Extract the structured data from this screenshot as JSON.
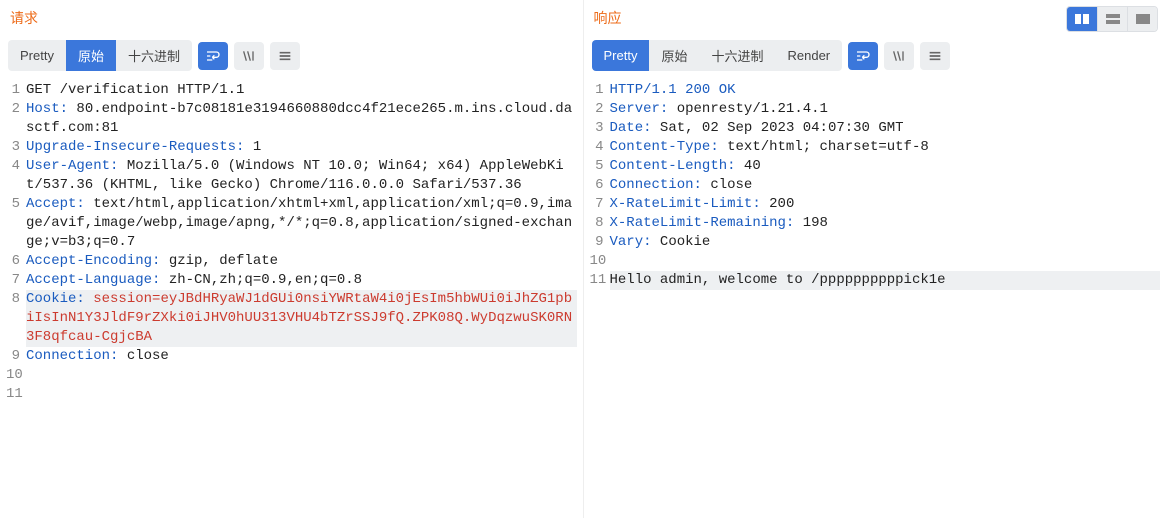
{
  "requestPanel": {
    "title": "请求",
    "tabs": [
      "Pretty",
      "原始",
      "十六进制"
    ],
    "activeTab": 1,
    "lineCount": 11,
    "lines": [
      [
        [
          "",
          "GET /verification HTTP/1.1"
        ]
      ],
      [
        [
          "b",
          "Host:"
        ],
        [
          "",
          " 80.endpoint-b7c08181e3194660880dcc4f21ece265.m.ins.cloud.dasctf.com:81"
        ]
      ],
      [
        [
          "b",
          "Upgrade-Insecure-Requests:"
        ],
        [
          "",
          " 1"
        ]
      ],
      [
        [
          "b",
          "User-Agent:"
        ],
        [
          "",
          " Mozilla/5.0 (Windows NT 10.0; Win64; x64) AppleWebKit/537.36 (KHTML, like Gecko) Chrome/116.0.0.0 Safari/537.36"
        ]
      ],
      [
        [
          "b",
          "Accept:"
        ],
        [
          "",
          " text/html,application/xhtml+xml,application/xml;q=0.9,image/avif,image/webp,image/apng,*/*;q=0.8,application/signed-exchange;v=b3;q=0.7"
        ]
      ],
      [
        [
          "b",
          "Accept-Encoding:"
        ],
        [
          "",
          " gzip, deflate"
        ]
      ],
      [
        [
          "b",
          "Accept-Language:"
        ],
        [
          "",
          " zh-CN,zh;q=0.9,en;q=0.8"
        ]
      ],
      [
        [
          "b",
          "Cookie:"
        ],
        [
          "r",
          " session="
        ],
        [
          "r",
          "eyJBdHRyaWJ1dGUi0nsiYWRtaW4i0jEsIm5hbWUi0iJhZG1pbiIsInN1Y3JldF9rZXki0iJHV0hUU313VHU4bTZrSSJ9fQ.ZPK08Q.WyDqzwuSK0RN3F8qfcau-CgjcBA"
        ]
      ],
      [
        [
          "b",
          "Connection:"
        ],
        [
          "",
          " close"
        ]
      ],
      [
        [
          "",
          ""
        ]
      ],
      [
        [
          "",
          ""
        ]
      ]
    ]
  },
  "responsePanel": {
    "title": "响应",
    "tabs": [
      "Pretty",
      "原始",
      "十六进制",
      "Render"
    ],
    "activeTab": 0,
    "lineCount": 11,
    "lines": [
      [
        [
          "b",
          "HTTP/1.1 200 OK"
        ]
      ],
      [
        [
          "b",
          "Server:"
        ],
        [
          "",
          " openresty/1.21.4.1"
        ]
      ],
      [
        [
          "b",
          "Date:"
        ],
        [
          "",
          " Sat, 02 Sep 2023 04:07:30 GMT"
        ]
      ],
      [
        [
          "b",
          "Content-Type:"
        ],
        [
          "",
          " text/html; charset=utf-8"
        ]
      ],
      [
        [
          "b",
          "Content-Length:"
        ],
        [
          "",
          " 40"
        ]
      ],
      [
        [
          "b",
          "Connection:"
        ],
        [
          "",
          " close"
        ]
      ],
      [
        [
          "b",
          "X-RateLimit-Limit:"
        ],
        [
          "",
          " 200"
        ]
      ],
      [
        [
          "b",
          "X-RateLimit-Remaining:"
        ],
        [
          "",
          " 198"
        ]
      ],
      [
        [
          "b",
          "Vary:"
        ],
        [
          "",
          " Cookie"
        ]
      ],
      [
        [
          "",
          ""
        ]
      ],
      [
        [
          "",
          "Hello admin, welcome to /ppppppppppick1e"
        ]
      ]
    ]
  }
}
